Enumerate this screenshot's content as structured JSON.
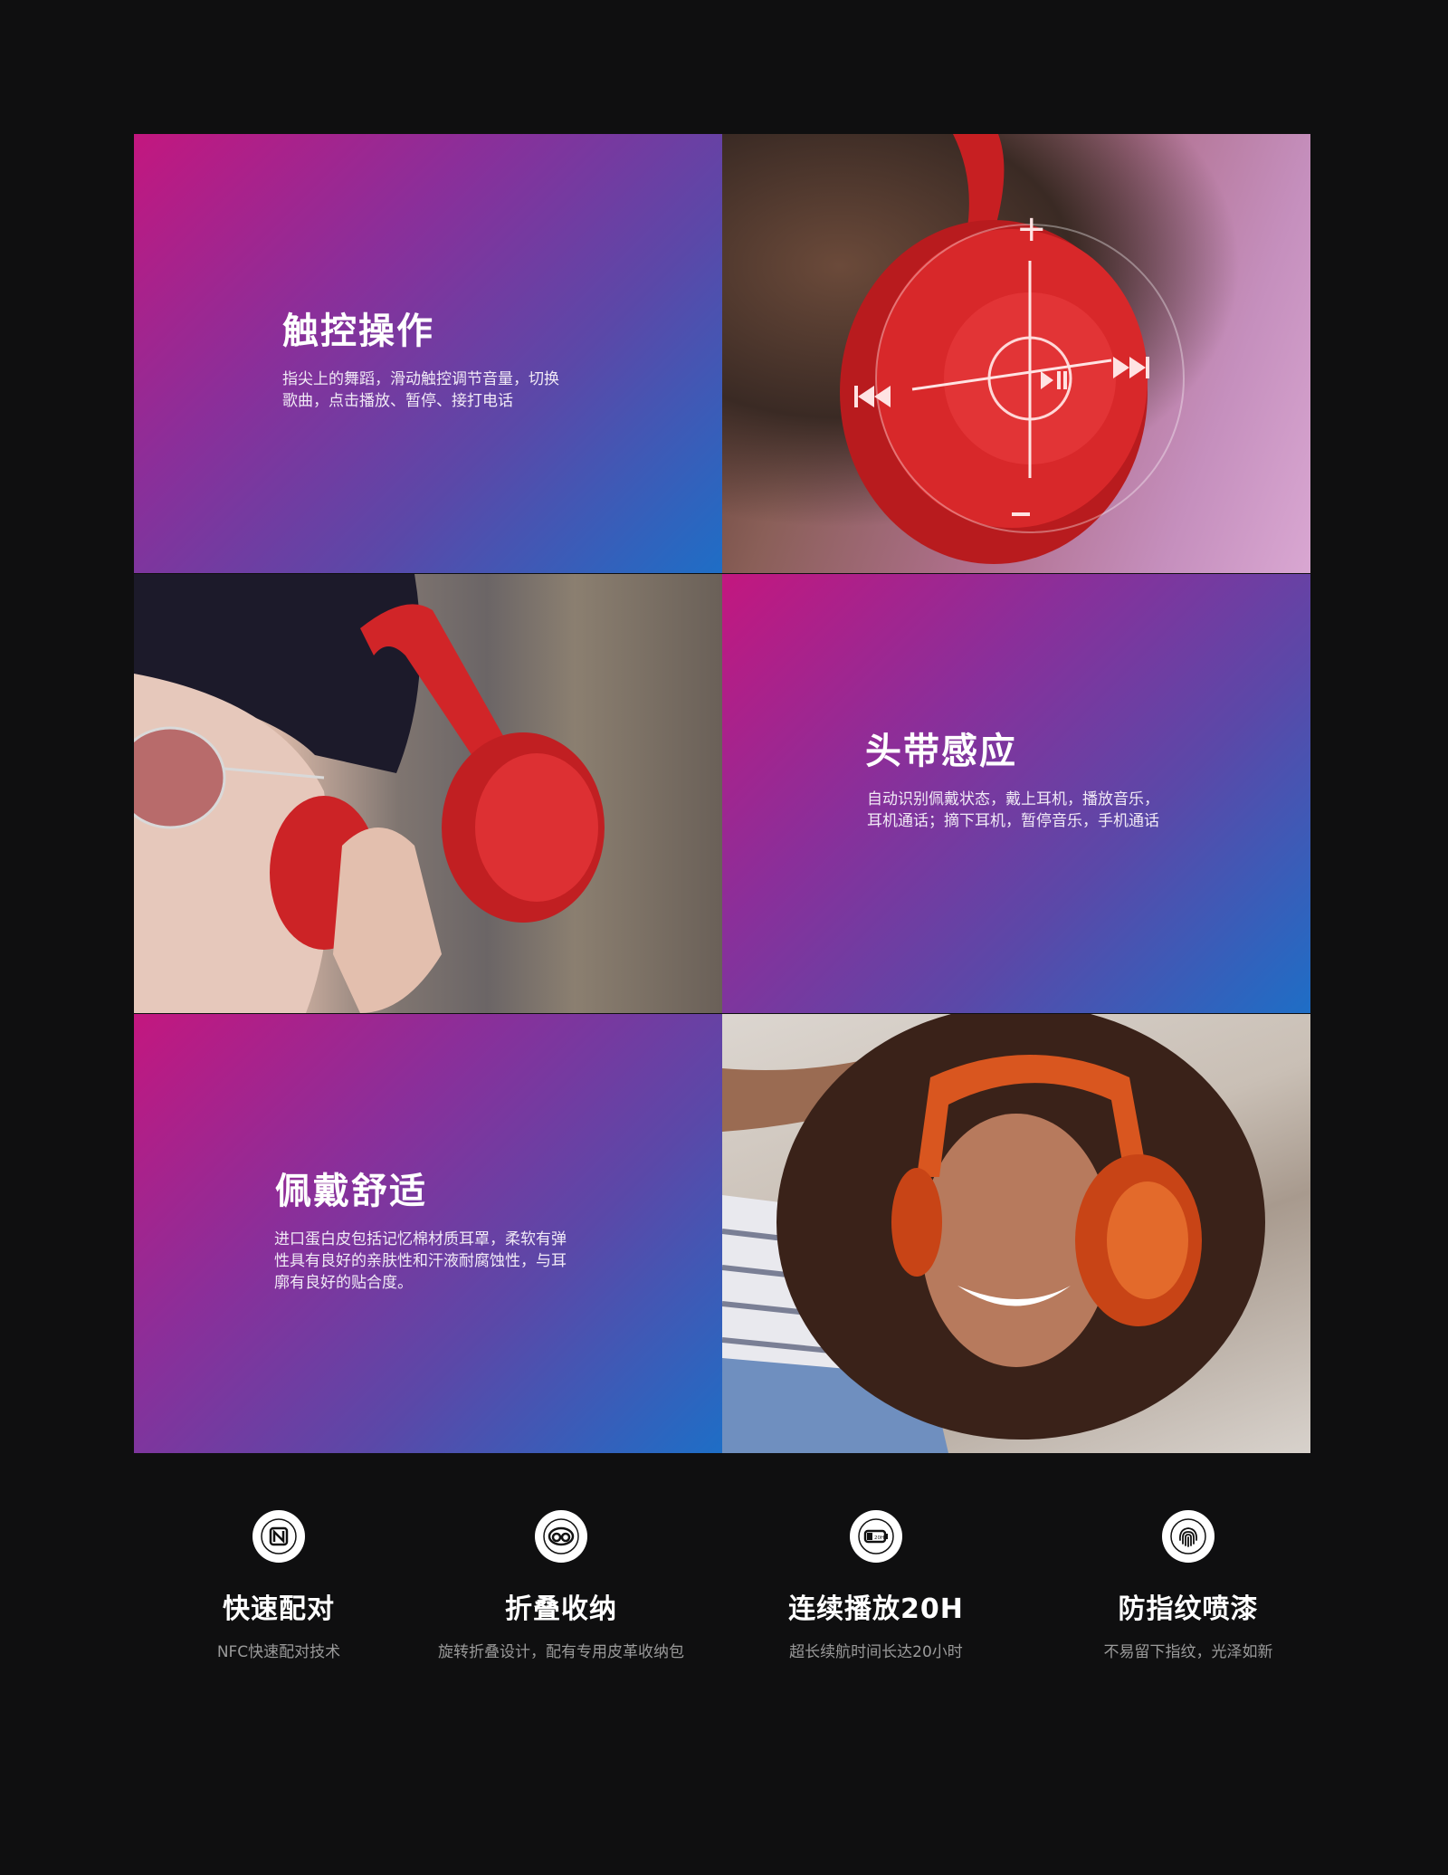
{
  "features": [
    {
      "title": "触控操作",
      "desc_line1": "指尖上的舞蹈，滑动触控调节音量，切换",
      "desc_line2": "歌曲，点击播放、暂停、接打电话"
    },
    {
      "title": "头带感应",
      "desc_line1": "自动识别佩戴状态，戴上耳机，播放音乐，",
      "desc_line2": "耳机通话；摘下耳机，暂停音乐，手机通话"
    },
    {
      "title": "佩戴舒适",
      "desc_line1": "进口蛋白皮包括记忆棉材质耳罩，柔软有弹",
      "desc_line2": "性具有良好的亲肤性和汗液耐腐蚀性，与耳",
      "desc_line3": "廓有良好的贴合度。"
    }
  ],
  "highlights": [
    {
      "icon": "nfc-icon",
      "title": "快速配对",
      "subtitle": "NFC快速配对技术"
    },
    {
      "icon": "fold-icon",
      "title": "折叠收纳",
      "subtitle": "旋转折叠设计，配有专用皮革收纳包"
    },
    {
      "icon": "battery-icon",
      "title": "连续播放20H",
      "subtitle": "超长续航时间长达20小时",
      "battery_label": "20H"
    },
    {
      "icon": "fingerprint-icon",
      "title": "防指纹喷漆",
      "subtitle": "不易留下指纹，光泽如新"
    }
  ],
  "colors": {
    "background": "#0f0f10",
    "gradient_start": "#c3177f",
    "gradient_end": "#1e6ec6",
    "headphone_red": "#d8282a"
  }
}
